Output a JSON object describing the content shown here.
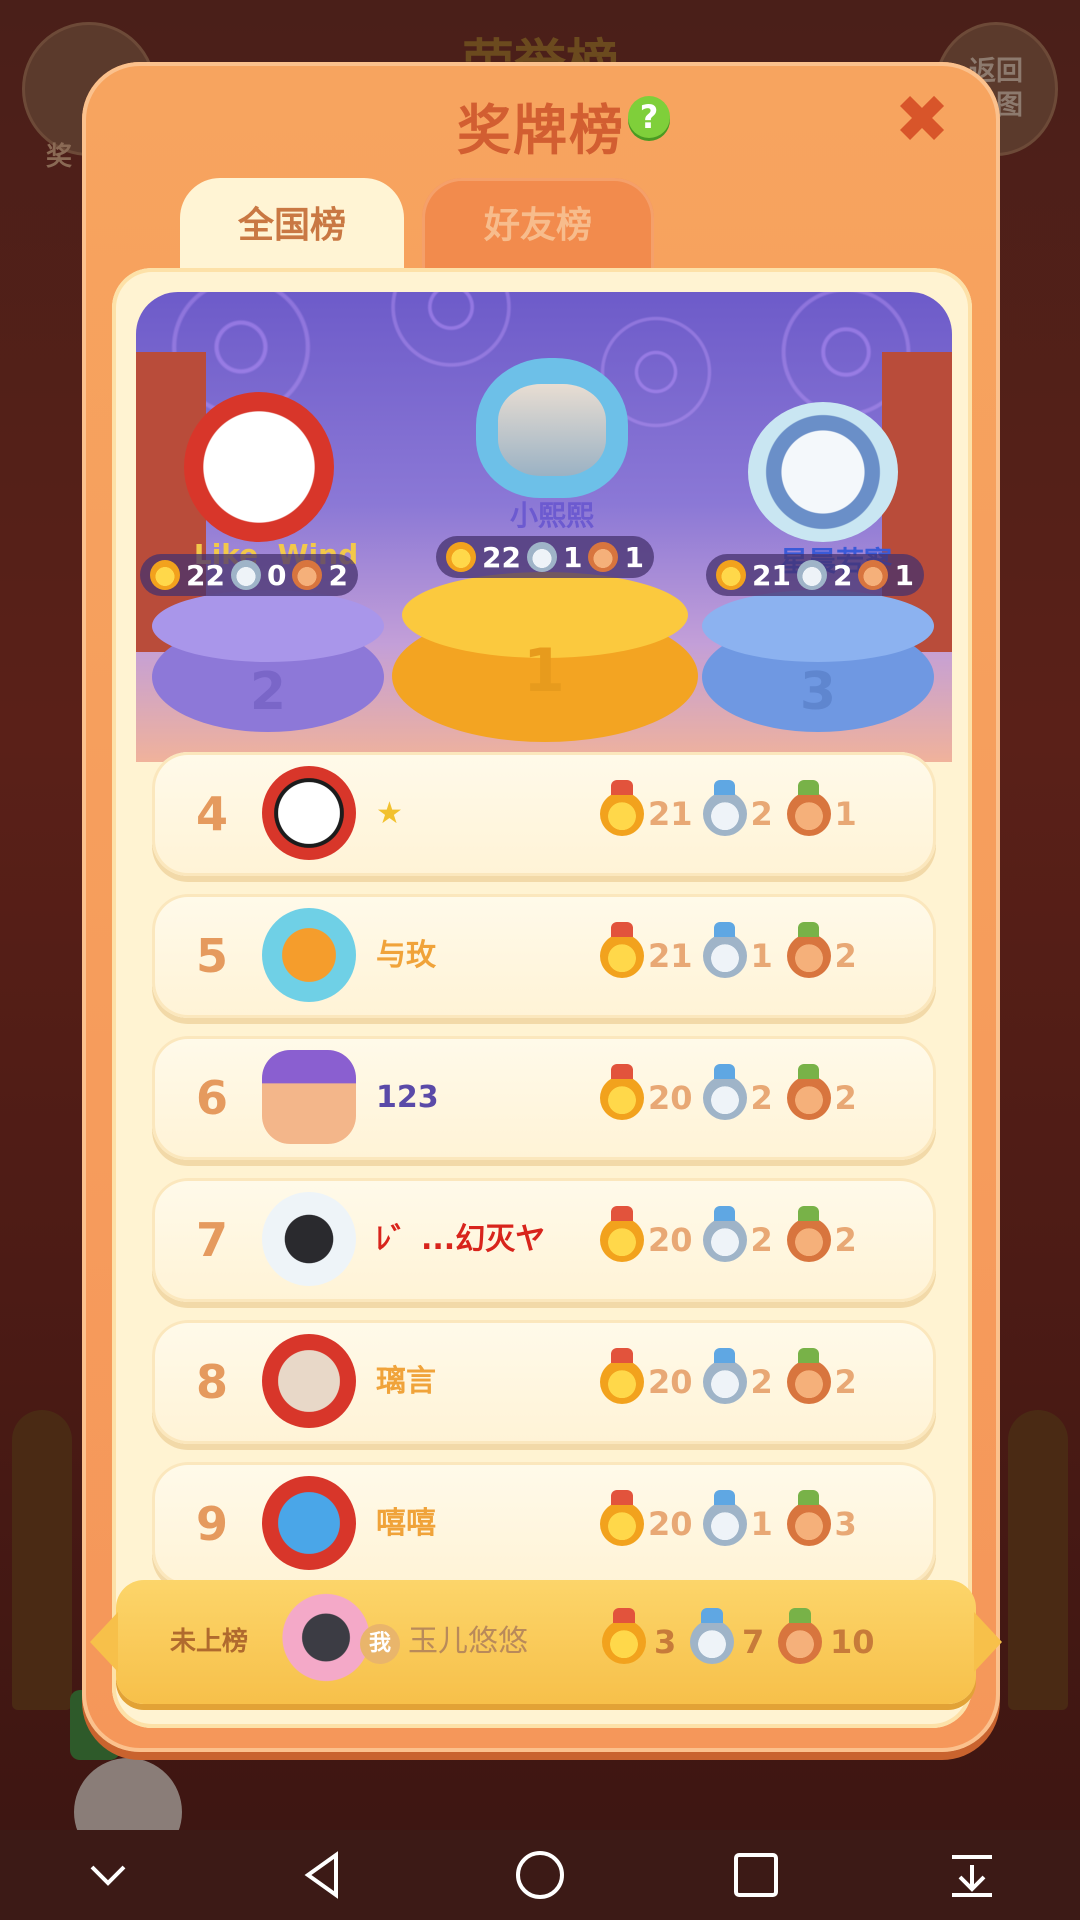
{
  "background": {
    "title": "荣誉榜",
    "left_button_label": "奖",
    "right_button_label": "返回\n地图"
  },
  "dialog": {
    "title": "奖牌榜",
    "help_icon": "?",
    "close_icon": "✖",
    "tabs": [
      {
        "label": "全国榜",
        "active": true
      },
      {
        "label": "好友榜",
        "active": false
      }
    ]
  },
  "podium": {
    "first": {
      "rank": "1",
      "name": "小熙熙",
      "gold": "22",
      "silver": "1",
      "bronze": "1"
    },
    "second": {
      "rank": "2",
      "name": "Like  Wind",
      "gold": "22",
      "silver": "0",
      "bronze": "2"
    },
    "third": {
      "rank": "3",
      "name": "星晨若寥",
      "gold": "21",
      "silver": "2",
      "bronze": "1"
    }
  },
  "rows": [
    {
      "rank": "4",
      "name": "★",
      "name_color": "#f2c12e",
      "gold": "21",
      "silver": "2",
      "bronze": "1"
    },
    {
      "rank": "5",
      "name": "与玫",
      "name_color": "#f0a33a",
      "gold": "21",
      "silver": "1",
      "bronze": "2"
    },
    {
      "rank": "6",
      "name": "123",
      "name_color": "#5a4aa8",
      "gold": "20",
      "silver": "2",
      "bronze": "2"
    },
    {
      "rank": "7",
      "name": "ﾚ゛...幻灭ヤ",
      "name_color": "#d8241c",
      "gold": "20",
      "silver": "2",
      "bronze": "2"
    },
    {
      "rank": "8",
      "name": "璃言",
      "name_color": "#f0a33a",
      "gold": "20",
      "silver": "2",
      "bronze": "2"
    },
    {
      "rank": "9",
      "name": "嘻嘻",
      "name_color": "#f0a33a",
      "gold": "20",
      "silver": "1",
      "bronze": "3"
    }
  ],
  "self": {
    "status": "未上榜",
    "me_badge": "我",
    "name": "玉儿悠悠",
    "gold": "3",
    "silver": "7",
    "bronze": "10"
  },
  "colors": {
    "dialog_orange": "#f7a45f",
    "panel_cream": "#fff3d2",
    "title_red": "#d25e31",
    "gold_pedestal": "#f6b52c",
    "silver_pedestal": "#9a86df",
    "bronze_pedestal": "#7fa7ea"
  },
  "navigation": [
    {
      "icon": "collapse-chevron-icon"
    },
    {
      "icon": "back-triangle-icon"
    },
    {
      "icon": "home-circle-icon"
    },
    {
      "icon": "recents-square-icon"
    },
    {
      "icon": "notification-pull-icon"
    }
  ]
}
